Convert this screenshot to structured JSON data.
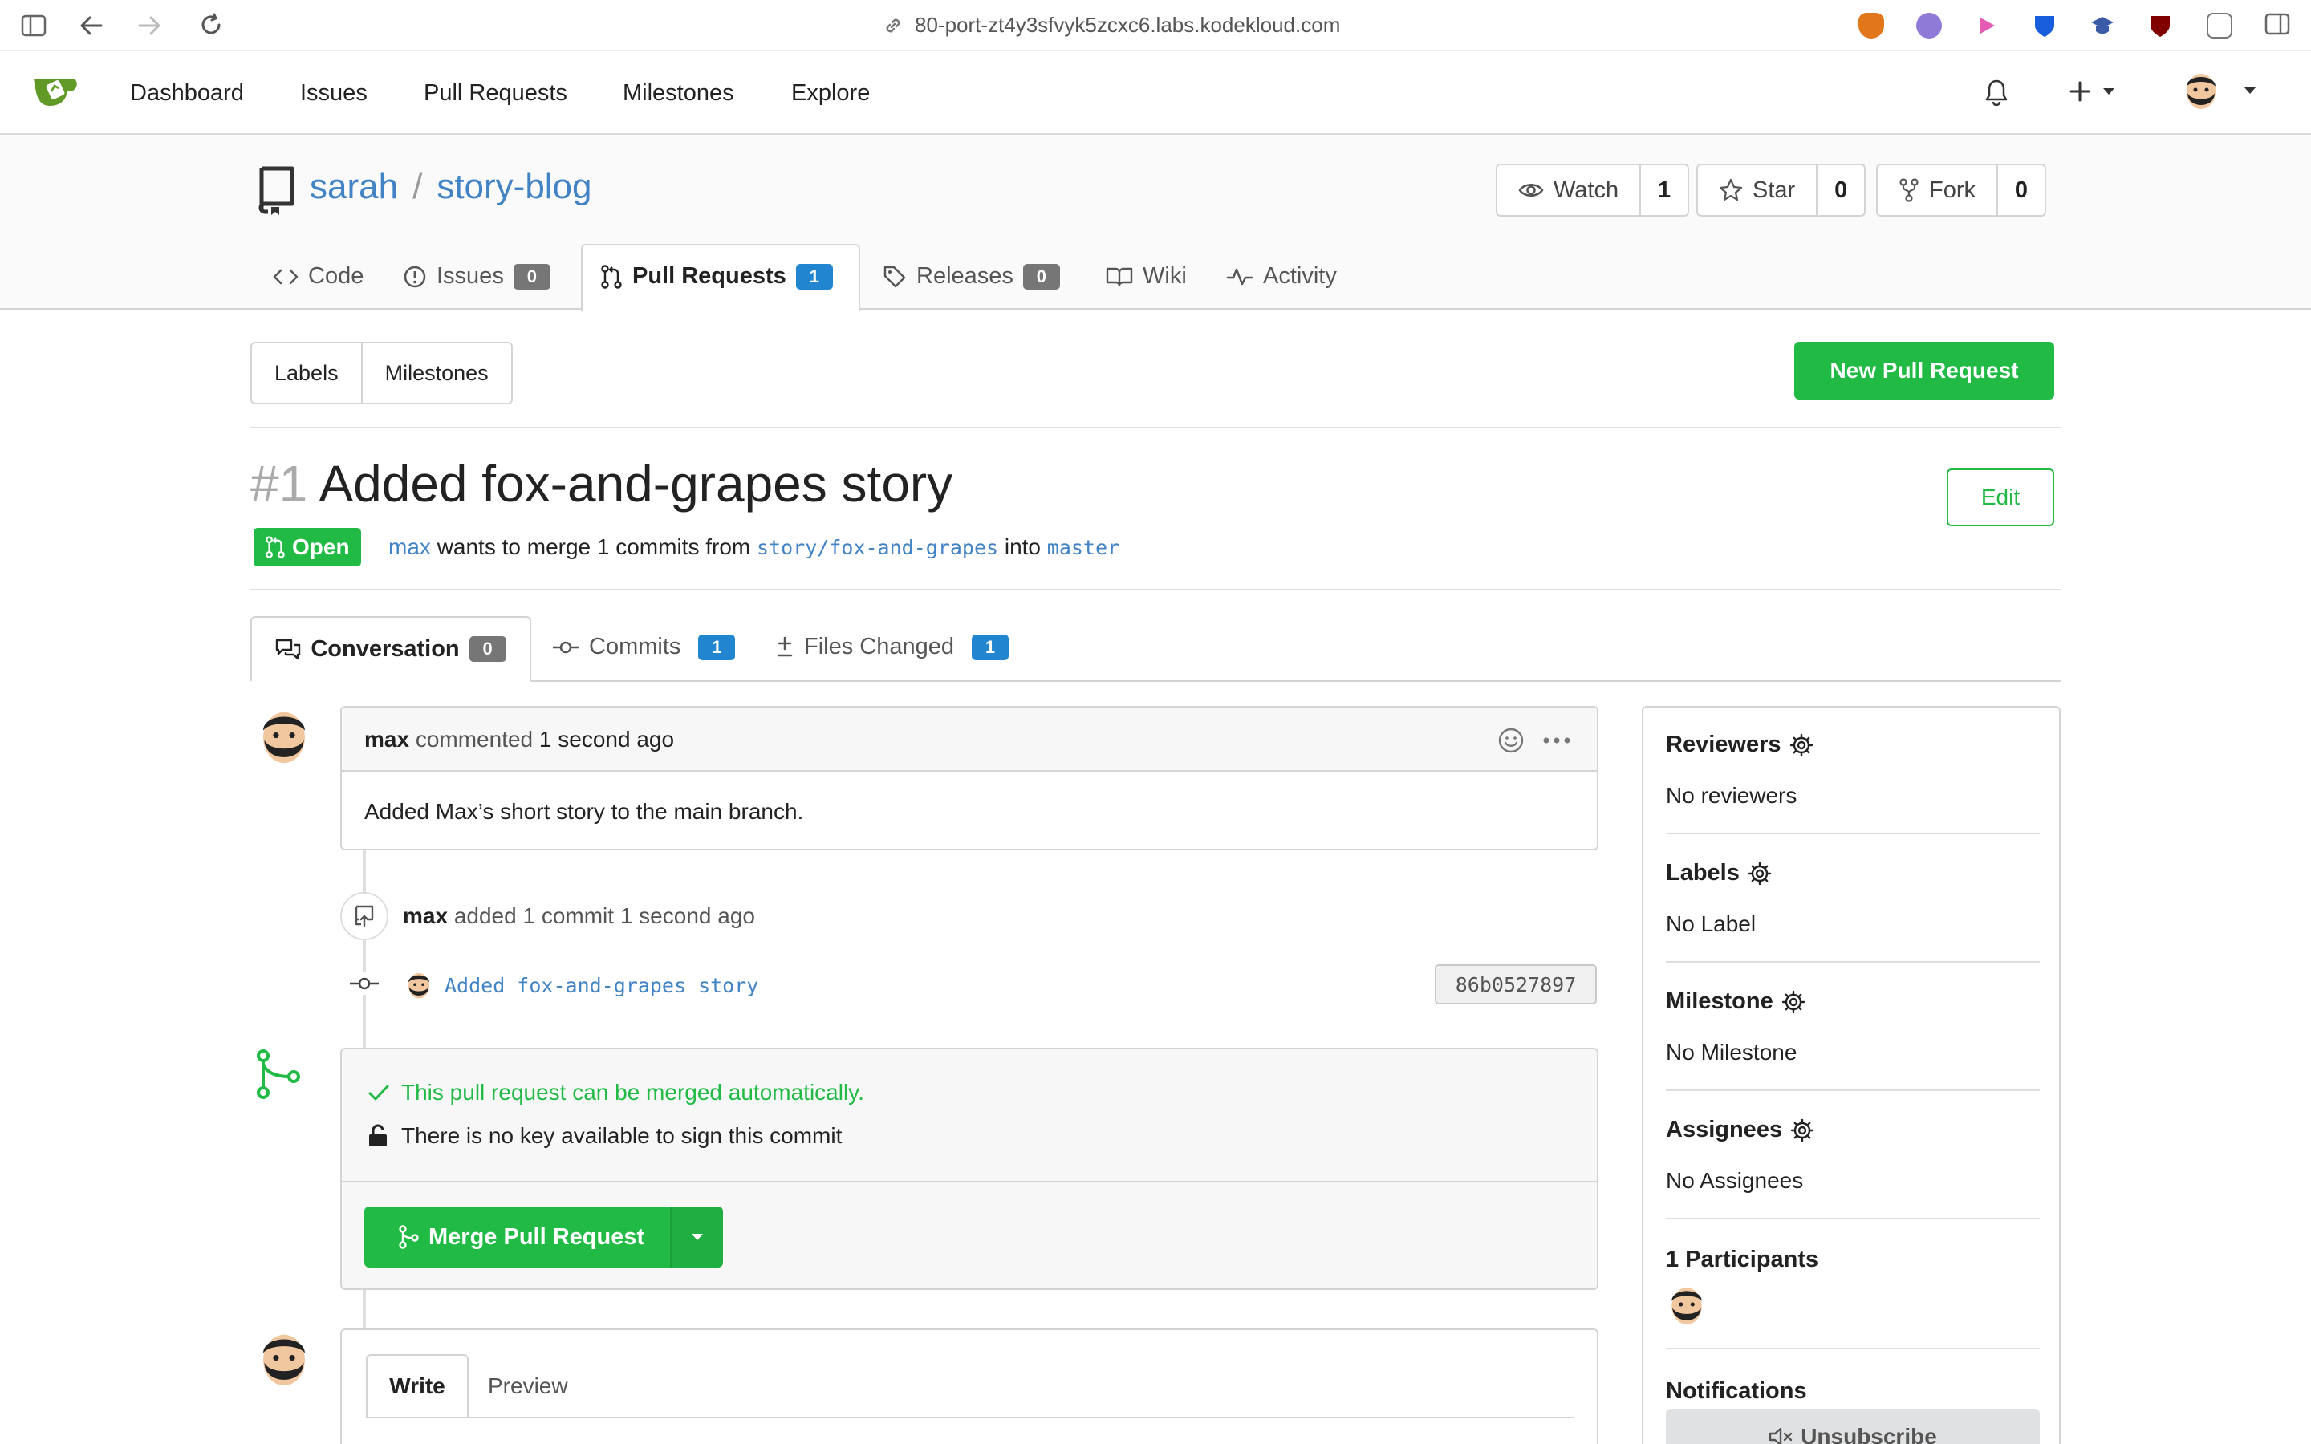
{
  "browser": {
    "url": "80-port-zt4y3sfvyk5zcxc6.labs.kodekloud.com"
  },
  "topnav": {
    "links": [
      "Dashboard",
      "Issues",
      "Pull Requests",
      "Milestones",
      "Explore"
    ]
  },
  "repo": {
    "owner": "sarah",
    "separator": "/",
    "name": "story-blog",
    "watch": {
      "label": "Watch",
      "count": "1"
    },
    "star": {
      "label": "Star",
      "count": "0"
    },
    "fork": {
      "label": "Fork",
      "count": "0"
    },
    "tabs": {
      "code": "Code",
      "issues": {
        "label": "Issues",
        "count": "0"
      },
      "pulls": {
        "label": "Pull Requests",
        "count": "1"
      },
      "releases": {
        "label": "Releases",
        "count": "0"
      },
      "wiki": "Wiki",
      "activity": "Activity"
    }
  },
  "toolbar": {
    "labels": "Labels",
    "milestones": "Milestones",
    "new_pr": "New Pull Request"
  },
  "pr": {
    "index": "#1",
    "title": "Added fox-and-grapes story",
    "edit": "Edit",
    "state": "Open",
    "author": "max",
    "merge_text_1": "wants to merge 1 commits from",
    "head_branch": "story/fox-and-grapes",
    "merge_text_2": "into",
    "base_branch": "master",
    "tabs": {
      "conversation": {
        "label": "Conversation",
        "count": "0"
      },
      "commits": {
        "label": "Commits",
        "count": "1"
      },
      "files": {
        "label": "Files Changed",
        "count": "1"
      }
    }
  },
  "comment": {
    "author": "max",
    "action": "commented",
    "time": "1 second ago",
    "body": "Added Max’s short story to the main branch."
  },
  "push_event": {
    "author": "max",
    "text": "added 1 commit",
    "time": "1 second ago",
    "commit_message": "Added fox-and-grapes story",
    "commit_sha": "86b0527897"
  },
  "merge": {
    "status": "This pull request can be merged automatically.",
    "signing": "There is no key available to sign this commit",
    "button": "Merge Pull Request"
  },
  "editor": {
    "write": "Write",
    "preview": "Preview"
  },
  "sidebar": {
    "reviewers": {
      "title": "Reviewers",
      "value": "No reviewers"
    },
    "labels": {
      "title": "Labels",
      "value": "No Label"
    },
    "milestone": {
      "title": "Milestone",
      "value": "No Milestone"
    },
    "assignees": {
      "title": "Assignees",
      "value": "No Assignees"
    },
    "participants": {
      "title": "1 Participants"
    },
    "notifications": {
      "title": "Notifications",
      "button": "Unsubscribe"
    }
  },
  "colors": {
    "accent_green": "#21ba45",
    "link_blue": "#4183c4",
    "badge_blue": "#2185d0"
  }
}
